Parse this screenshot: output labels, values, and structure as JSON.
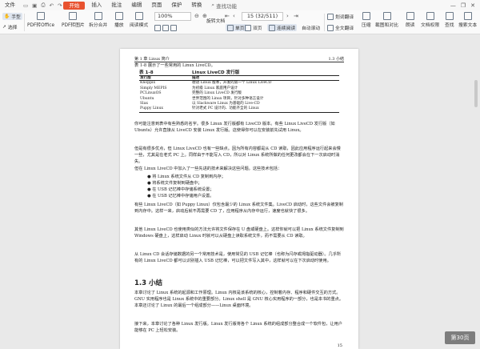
{
  "menu": {
    "items": [
      "文件",
      "开始",
      "插入",
      "批注",
      "编辑",
      "页面",
      "保护",
      "转换"
    ],
    "active": "开始",
    "search_label": "查找功能",
    "right_icons": [
      "minimize-icon",
      "restore-icon",
      "close-icon"
    ]
  },
  "ribbon": {
    "hand_tool": "手型",
    "select_tool": "选择",
    "pdf_to_office": "PDF转Office",
    "pdf_to_image": "PDF转图片",
    "split_merge": "拆分合并",
    "play": "播放",
    "read_mode": "阅读模式",
    "zoom_value": "100%",
    "rotate_doc": "旋转文档",
    "single_page": "单页",
    "double_page": "双页",
    "continuous_read": "连续阅读",
    "auto_scroll": "自动滚动",
    "page_value": "15 (32/511)",
    "translate": "划词翻译",
    "full_translate": "全文翻译",
    "compress": "压缩",
    "screenshot_compare": "截图和对比",
    "read_aloud": "朗读",
    "doc_rights": "文档权限",
    "search_replace": "查找",
    "text_icon": "文",
    "count_label": "搜索文本"
  },
  "document": {
    "running_header_left": "第 1 章  Linux 简介",
    "running_header_right": "1.3  小结",
    "table_intro": "表 1-8 展示了一些常用的 Linux LiveCD。",
    "table_caption_no": "表 1-8",
    "table_caption": "Linux LiveCD 发行版",
    "table_headers": [
      "发行版",
      "描述"
    ],
    "table_rows": [
      [
        "Knoppix",
        "德语 Linux 版本，开发的第一个 Linux LiveCD"
      ],
      [
        "Simply MEPIS",
        "为初级 Linux 家庭用户设计"
      ],
      [
        "PCLinuxOS",
        "完整的 Linux LiveCD 发行版"
      ],
      [
        "Ubuntu",
        "世界范围的 Linux 项目，针对多种语言设计"
      ],
      [
        "Slax",
        "以 Slackware Linux 为基础的 Live-CD"
      ],
      [
        "Puppy Linux",
        "针对老式 PC 设计的、功能齐全的 Linux"
      ]
    ],
    "para1": "你可能注意到表中有些熟悉的名字。很多 Linux 发行版都有 LiveCD 版本。有些 Linux LiveCD 发行版（如 Ubuntu）允许直接从 LiveCD 安装 Linux 发行版。这使得你可以在安装前先试用 Linux。",
    "para2": "但是有很多优点，但 Linux LiveCD 也有一些缺点。因为所有内容都是从 CD 读取，因此应用程序运行起来会慢一些，尤其是在老式 PC 上。同样由于不能写入 CD，所以对 Linux 系统所做的任何更改都会在下一次启动时消失。",
    "para3": "但在 Linux LiveCD 中加入了一些先进的技术来解决这些问题。这些技术包括：",
    "bullets": [
      "将 Linux 系统文件从 CD 复制到内存；",
      "将系统文件复制到硬盘中；",
      "在 USB 记忆棒中存储系统设置；",
      "在 USB 记忆棒中存储用户设置。"
    ],
    "para4": "有些 Linux LiveCD（如 Puppy Linux）仅包含最少的 Linux 系统文件集。LiveCD 启动时，这些文件会被复制到内存中。这样一来，启动后就不再需要 CD 了，应用程序从内存中运行，速度也就快了很多。",
    "para5": "其他 Linux LiveCD 也使用类似的方法允许将文件保存在 U 盘或硬盘上。这样你就可以把 Linux 系统文件复制到 Windows 硬盘上，这样启动 Linux 时就可以从硬盘上读取系统文件，而不需要从 CD 读取。",
    "para6": "从 Linux CD 会话存储数据的另一个常用技术是，使用常见的 USB 记忆棒（也称为闪存或拇指驱动器）。几乎所有的 Linux LiveCD 都可以识别插入 USB 记忆棒，可以把文件写入其中，这样就可以在下次启动时使用。",
    "section_title": "1.3  小结",
    "para7": "本章讨论了 Linux 系统的起源和工作原理。Linux 内核是该系统的核心，控制着内存、程序和硬件交互的方式。GNU 实用程序也是 Linux 系统中的重要部分。Linux shell 是 GNU 核心实用程序的一部分，也是本书的重点。本章还讨论了 Linux 的最后一个组成部分——Linux 桌面环境。",
    "para8": "接下来，本章讨论了各种 Linux 发行版。Linux 发行版将各个 Linux 系统的组成部分整合成一个软件包，让用户能够在 PC 上轻松安装。",
    "page_number": "15"
  },
  "pager_label": "第30页"
}
